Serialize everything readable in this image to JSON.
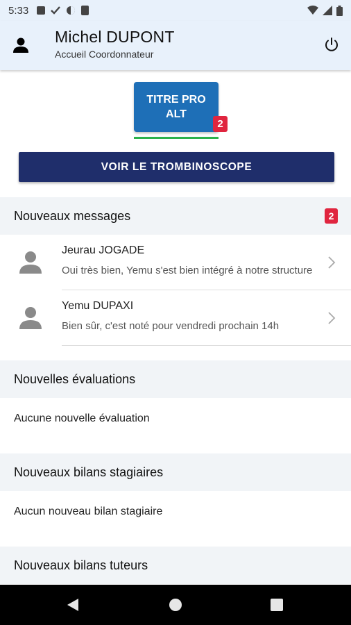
{
  "status_bar": {
    "time": "5:33"
  },
  "header": {
    "name": "Michel DUPONT",
    "role": "Accueil Coordonnateur"
  },
  "titre_button": {
    "label": "TITRE PRO ALT",
    "badge": "2"
  },
  "trombinoscope_button": {
    "label": "VOIR LE TROMBINOSCOPE"
  },
  "messages": {
    "title": "Nouveaux messages",
    "badge": "2",
    "items": [
      {
        "sender": "Jeurau JOGADE",
        "preview": "Oui très bien, Yemu s'est bien intégré à notre structure"
      },
      {
        "sender": "Yemu DUPAXI",
        "preview": "Bien sûr, c'est noté pour vendredi prochain 14h"
      }
    ]
  },
  "evaluations": {
    "title": "Nouvelles évaluations",
    "empty": "Aucune nouvelle évaluation"
  },
  "bilans_stagiaires": {
    "title": "Nouveaux bilans stagiaires",
    "empty": "Aucun nouveau bilan stagiaire"
  },
  "bilans_tuteurs": {
    "title": "Nouveaux bilans tuteurs"
  },
  "colors": {
    "header_bg": "#e8f1fb",
    "titre_btn": "#1e6fb7",
    "trombi_btn": "#1f2e6b",
    "badge": "#e0253f",
    "underline": "#2bb24c"
  }
}
